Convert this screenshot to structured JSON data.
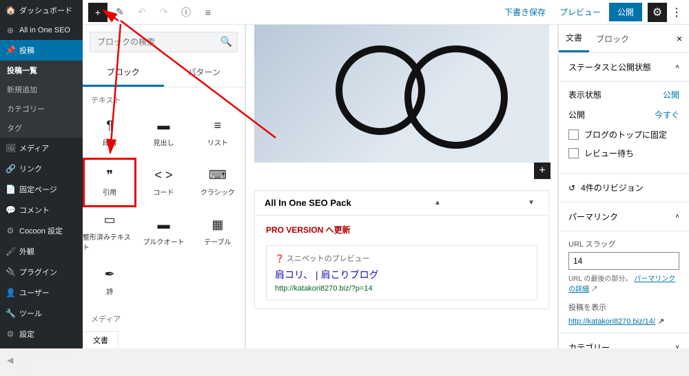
{
  "sidebar": {
    "items": [
      {
        "icon": "🏠",
        "label": "ダッシュボード"
      },
      {
        "icon": "⊕",
        "label": "All in One SEO"
      },
      {
        "icon": "📌",
        "label": "投稿"
      },
      {
        "icon": "🖼",
        "label": "メディア"
      },
      {
        "icon": "🔗",
        "label": "リンク"
      },
      {
        "icon": "📄",
        "label": "固定ページ"
      },
      {
        "icon": "💬",
        "label": "コメント"
      },
      {
        "icon": "⚙",
        "label": "Cocoon 設定"
      },
      {
        "icon": "🖌",
        "label": "外観"
      },
      {
        "icon": "🔌",
        "label": "プラグイン"
      },
      {
        "icon": "👤",
        "label": "ユーザー"
      },
      {
        "icon": "🔧",
        "label": "ツール"
      },
      {
        "icon": "⚙",
        "label": "設定"
      },
      {
        "icon": "◀",
        "label": "メニューを閉じる"
      }
    ],
    "subs": [
      "投稿一覧",
      "新規追加",
      "カテゴリー",
      "タグ"
    ]
  },
  "topbar": {
    "save_draft": "下書き保存",
    "preview": "プレビュー",
    "publish": "公開"
  },
  "inserter": {
    "search_placeholder": "ブロックの検索",
    "tabs": [
      "ブロック",
      "パターン"
    ],
    "section_text": "テキスト",
    "section_media": "メディア",
    "blocks": [
      {
        "icon": "¶",
        "label": "段落"
      },
      {
        "icon": "▬",
        "label": "見出し"
      },
      {
        "icon": "≡",
        "label": "リスト"
      },
      {
        "icon": "❞",
        "label": "引用"
      },
      {
        "icon": "< >",
        "label": "コード"
      },
      {
        "icon": "⌨",
        "label": "クラシック"
      },
      {
        "icon": "▭",
        "label": "整形済みテキスト"
      },
      {
        "icon": "▬",
        "label": "プルクオート"
      },
      {
        "icon": "▦",
        "label": "テーブル"
      },
      {
        "icon": "✒",
        "label": "詩"
      }
    ],
    "media_blocks": [
      {
        "icon": "🖼",
        "label": ""
      },
      {
        "icon": "▭",
        "label": ""
      },
      {
        "icon": "♪",
        "label": ""
      }
    ]
  },
  "metabox": {
    "title": "All In One SEO Pack",
    "pro": "PRO VERSION へ更新",
    "snippet_label": "スニペットのプレビュー",
    "snippet_title": "肩コリ、 | 肩こりブログ",
    "snippet_url": "http://katakori8270.biz/?p=14"
  },
  "settings": {
    "tabs": [
      "文書",
      "ブロック"
    ],
    "status_title": "ステータスと公開状態",
    "visibility_label": "表示状態",
    "visibility_value": "公開",
    "publish_label": "公開",
    "publish_value": "今すぐ",
    "sticky": "ブログのトップに固定",
    "pending": "レビュー待ち",
    "revisions": "4件のリビジョン",
    "permalink_title": "パーマリンク",
    "slug_label": "URL スラッグ",
    "slug_value": "14",
    "slug_hint_prefix": "URL の最後の部分。 ",
    "slug_hint_link": "パーマリンクの詳細",
    "view_post": "投稿を表示",
    "permalink_url": "http://katakori8270.biz/14/",
    "category_title": "カテゴリー"
  },
  "bottom_tab": "文書"
}
